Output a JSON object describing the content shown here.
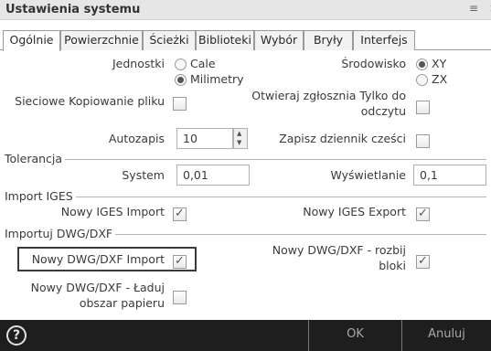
{
  "window": {
    "title": "Ustawienia systemu",
    "controls": "≡ ×"
  },
  "tabs": [
    {
      "label": "Ogólnie",
      "active": true
    },
    {
      "label": "Powierzchnie",
      "active": false
    },
    {
      "label": "Ścieżki",
      "active": false
    },
    {
      "label": "Biblioteki",
      "active": false
    },
    {
      "label": "Wybór",
      "active": false
    },
    {
      "label": "Bryły",
      "active": false
    },
    {
      "label": "Interfejs",
      "active": false
    }
  ],
  "general": {
    "units_label": "Jednostki",
    "units_options": [
      {
        "label": "Cale",
        "selected": false
      },
      {
        "label": "Milimetry",
        "selected": true
      }
    ],
    "environment_label": "Środowisko",
    "environment_options": [
      {
        "label": "XY",
        "selected": true
      },
      {
        "label": "ZX",
        "selected": false
      }
    ],
    "network_copy_label": "Sieciowe Kopiowanie pliku",
    "network_copy_checked": false,
    "open_readonly_label": "Otwieraj zgłosznia Tylko do odczytu",
    "open_readonly_checked": false,
    "autosave_label": "Autozapis",
    "autosave_value": "10",
    "save_log_label": "Zapisz dziennik cześci",
    "save_log_checked": false
  },
  "tolerance": {
    "group_label": "Tolerancja",
    "system_label": "System",
    "system_value": "0,01",
    "display_label": "Wyświetlanie",
    "display_value": "0,1"
  },
  "iges": {
    "group_label": "Import IGES",
    "new_import_label": "Nowy IGES Import",
    "new_import_checked": true,
    "new_export_label": "Nowy IGES Export",
    "new_export_checked": true
  },
  "dwg": {
    "group_label": "Importuj DWG/DXF",
    "new_import_label": "Nowy DWG/DXF Import",
    "new_import_checked": true,
    "explode_blocks_label": "Nowy DWG/DXF - rozbij bloki",
    "explode_blocks_checked": true,
    "load_paper_label": "Nowy DWG/DXF - Ładuj obszar papieru",
    "load_paper_checked": false
  },
  "footer": {
    "help_icon": "?",
    "ok_label": "OK",
    "cancel_label": "Anuluj"
  },
  "colors": {
    "footer_bg": "#1e1e1e",
    "title_bg": "#e6e6e6"
  }
}
